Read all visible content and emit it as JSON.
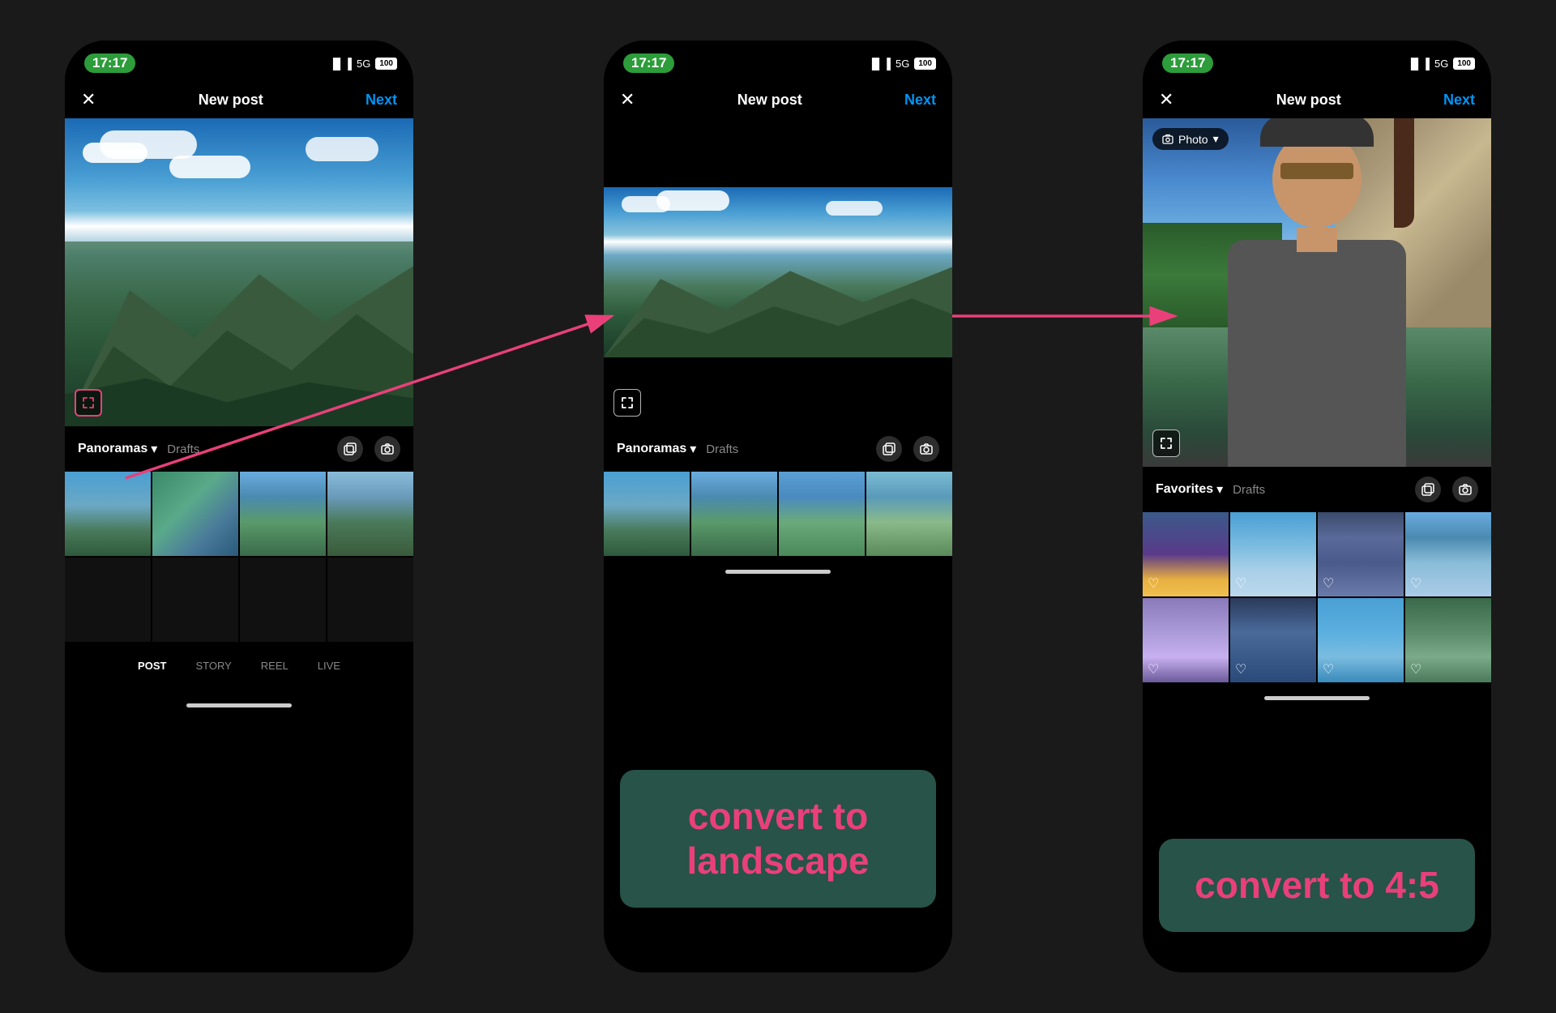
{
  "phones": [
    {
      "id": "phone1",
      "status": {
        "time": "17:17",
        "signal": "5G",
        "battery": "100"
      },
      "nav": {
        "close": "✕",
        "title": "New post",
        "next": "Next"
      },
      "album": "Panoramas",
      "drafts": "Drafts",
      "imageType": "landscape",
      "tabs": [
        "POST",
        "STORY",
        "REEL",
        "LIVE"
      ],
      "activeTab": "POST"
    },
    {
      "id": "phone2",
      "status": {
        "time": "17:17",
        "signal": "5G",
        "battery": "100"
      },
      "nav": {
        "close": "✕",
        "title": "New post",
        "next": "Next"
      },
      "album": "Panoramas",
      "drafts": "Drafts",
      "imageType": "panorama",
      "label": "convert to\nlandscape"
    },
    {
      "id": "phone3",
      "status": {
        "time": "17:17",
        "signal": "5G",
        "battery": "100"
      },
      "nav": {
        "close": "✕",
        "title": "New post",
        "next": "Next"
      },
      "album": "Favorites",
      "drafts": "Drafts",
      "imageType": "selfie",
      "photoBadge": "Photo",
      "label": "convert to\n4:5"
    }
  ],
  "labels": {
    "convertLandscape": "convert to\nlandscape",
    "convert45": "convert to\n4:5"
  },
  "tabs": {
    "post": "POST",
    "story": "STORY",
    "reel": "REEL",
    "live": "LIVE"
  }
}
